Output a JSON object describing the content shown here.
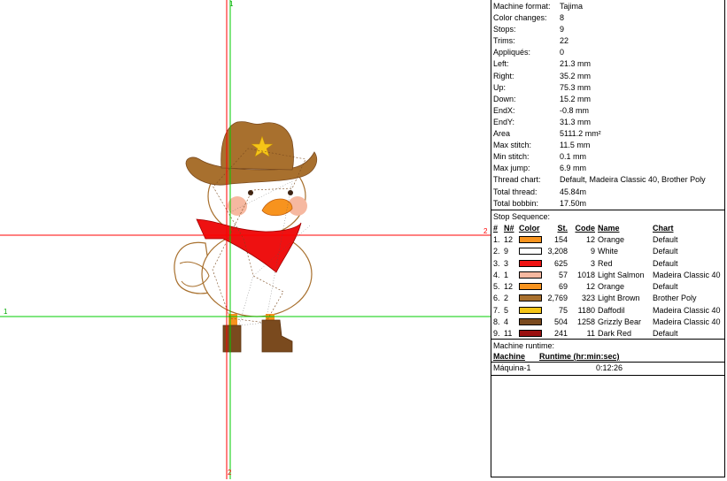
{
  "design_info": [
    {
      "label": "Machine format:",
      "value": "Tajima"
    },
    {
      "label": "Color changes:",
      "value": "8"
    },
    {
      "label": "Stops:",
      "value": "9"
    },
    {
      "label": "Trims:",
      "value": "22"
    },
    {
      "label": "Appliqués:",
      "value": "0"
    },
    {
      "label": "Left:",
      "value": "21.3 mm"
    },
    {
      "label": "Right:",
      "value": "35.2 mm"
    },
    {
      "label": "Up:",
      "value": "75.3 mm"
    },
    {
      "label": "Down:",
      "value": "15.2 mm"
    },
    {
      "label": "EndX:",
      "value": "-0.8 mm"
    },
    {
      "label": "EndY:",
      "value": "31.3 mm"
    },
    {
      "label": "Area",
      "value": "5111.2 mm²"
    },
    {
      "label": "Max stitch:",
      "value": "11.5 mm"
    },
    {
      "label": "Min stitch:",
      "value": "0.1 mm"
    },
    {
      "label": "Max jump:",
      "value": "6.9 mm"
    },
    {
      "label": "Thread chart:",
      "value": "Default, Madeira Classic 40, Brother Poly"
    },
    {
      "label": "Total thread:",
      "value": "45.84m"
    },
    {
      "label": "Total bobbin:",
      "value": "17.50m"
    }
  ],
  "stop_sequence": {
    "title": "Stop Sequence:",
    "columns": {
      "num": "#",
      "n": "N#",
      "color": "Color",
      "st": "St.",
      "code": "Code",
      "name": "Name",
      "chart": "Chart"
    },
    "rows": [
      {
        "num": "1.",
        "n": "12",
        "color": "#f7931e",
        "st": "154",
        "code": "12",
        "name": "Orange",
        "chart": "Default"
      },
      {
        "num": "2.",
        "n": "9",
        "color": "#ffffff",
        "st": "3,208",
        "code": "9",
        "name": "White",
        "chart": "Default"
      },
      {
        "num": "3.",
        "n": "3",
        "color": "#ee1111",
        "st": "625",
        "code": "3",
        "name": "Red",
        "chart": "Default"
      },
      {
        "num": "4.",
        "n": "1",
        "color": "#f6b8a0",
        "st": "57",
        "code": "1018",
        "name": "Light Salmon",
        "chart": "Madeira Classic 40"
      },
      {
        "num": "5.",
        "n": "12",
        "color": "#f7931e",
        "st": "69",
        "code": "12",
        "name": "Orange",
        "chart": "Default"
      },
      {
        "num": "6.",
        "n": "2",
        "color": "#a8702e",
        "st": "2,769",
        "code": "323",
        "name": "Light Brown",
        "chart": "Brother Poly"
      },
      {
        "num": "7.",
        "n": "5",
        "color": "#f5c518",
        "st": "75",
        "code": "1180",
        "name": "Daffodil",
        "chart": "Madeira Classic 40"
      },
      {
        "num": "8.",
        "n": "4",
        "color": "#7a4a1e",
        "st": "504",
        "code": "1258",
        "name": "Grizzly Bear",
        "chart": "Madeira Classic 40"
      },
      {
        "num": "9.",
        "n": "11",
        "color": "#9a1010",
        "st": "241",
        "code": "11",
        "name": "Dark Red",
        "chart": "Default"
      }
    ]
  },
  "runtime": {
    "title": "Machine runtime:",
    "col_machine": "Machine",
    "col_runtime": "Runtime (hr:min:sec)",
    "machine": "Máquina-1",
    "time": "0:12:26"
  },
  "axes": {
    "top_label": "1",
    "bottom_label": "2",
    "left_label": "1",
    "right_label": "2"
  },
  "colors": {
    "axis_red": "#ff0000",
    "axis_green": "#00cc00",
    "hat_brown": "#a8702e",
    "bandana_red": "#ee1111",
    "beak_orange": "#f7931e",
    "cheek_salmon": "#f6b8a0",
    "star_yellow": "#f5c518",
    "boot_brown": "#7a4a1e"
  }
}
